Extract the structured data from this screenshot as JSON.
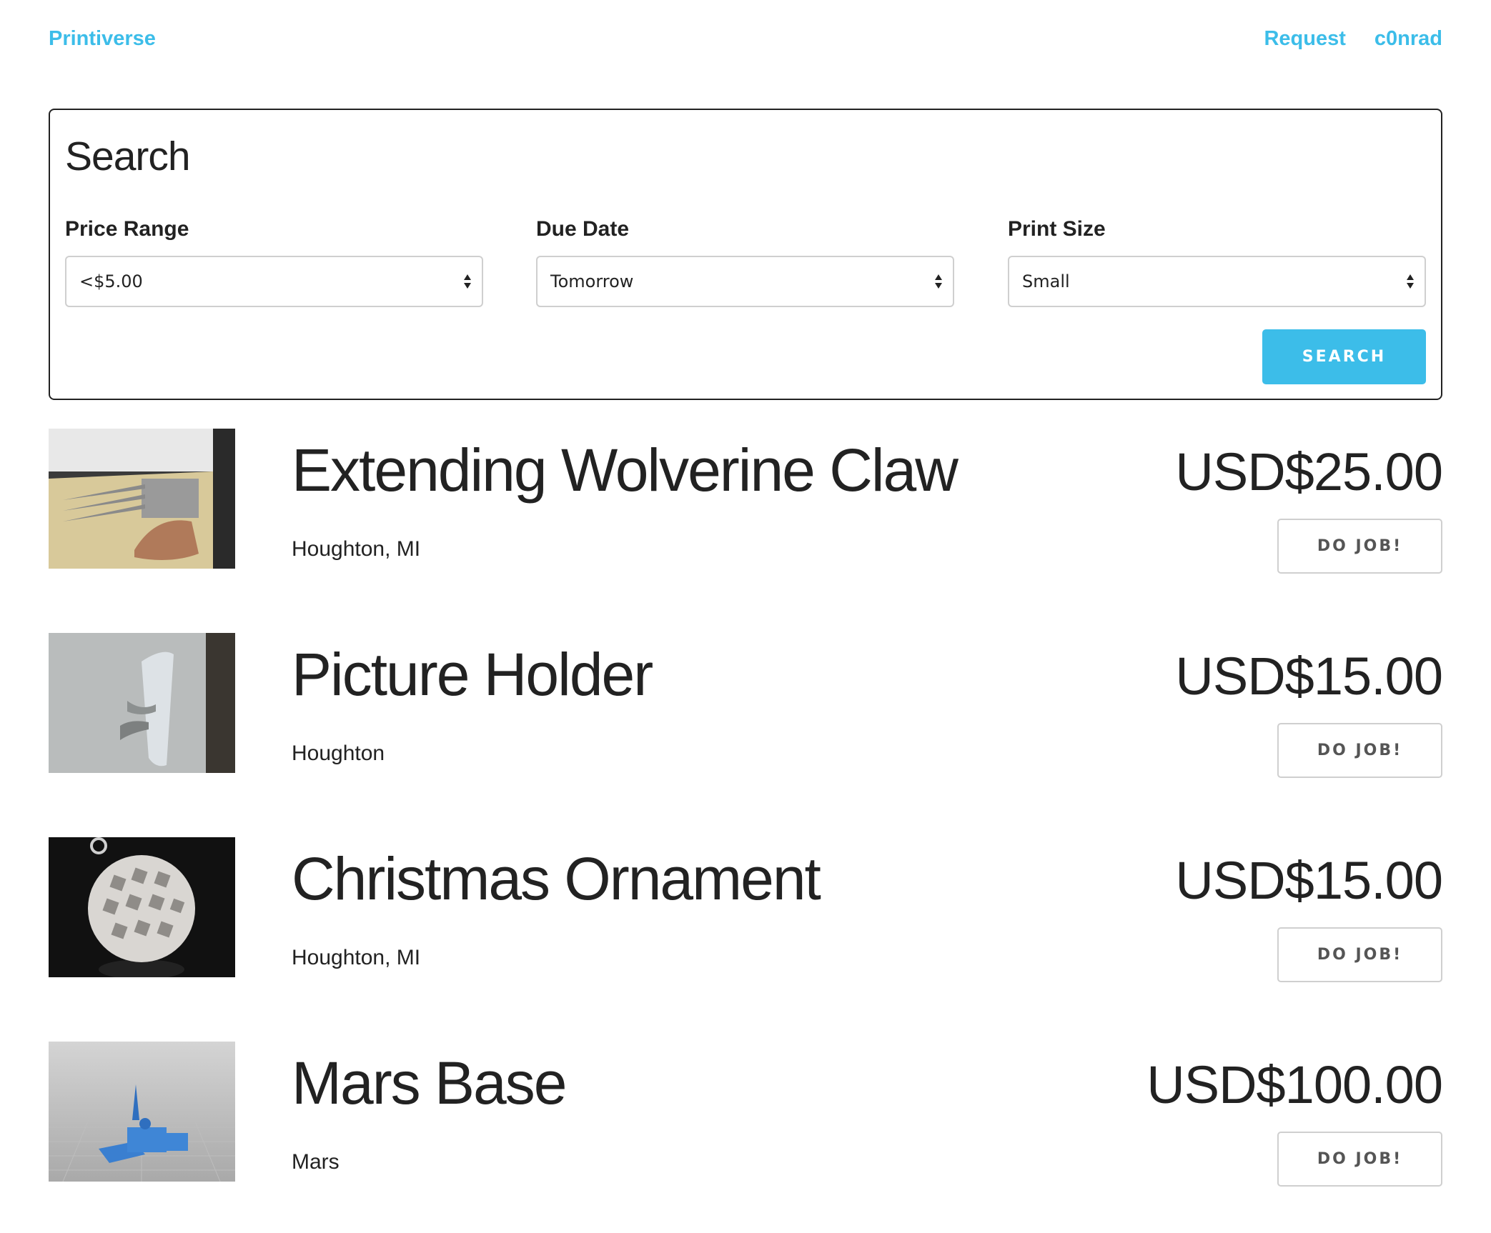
{
  "nav": {
    "brand": "Printiverse",
    "links": [
      {
        "label": "Request"
      },
      {
        "label": "c0nrad"
      }
    ]
  },
  "search": {
    "title": "Search",
    "fields": [
      {
        "label": "Price Range",
        "value": "<$5.00"
      },
      {
        "label": "Due Date",
        "value": "Tomorrow"
      },
      {
        "label": "Print Size",
        "value": "Small"
      }
    ],
    "button_label": "SEARCH"
  },
  "listings": [
    {
      "title": "Extending Wolverine Claw",
      "location": "Houghton, MI",
      "price": "USD$25.00",
      "button_label": "DO JOB!"
    },
    {
      "title": "Picture Holder",
      "location": "Houghton",
      "price": "USD$15.00",
      "button_label": "DO JOB!"
    },
    {
      "title": "Christmas Ornament",
      "location": "Houghton, MI",
      "price": "USD$15.00",
      "button_label": "DO JOB!"
    },
    {
      "title": "Mars Base",
      "location": "Mars",
      "price": "USD$100.00",
      "button_label": "DO JOB!"
    }
  ],
  "colors": {
    "accent": "#3cbde9",
    "text": "#222222",
    "border": "#cfcfcf"
  }
}
